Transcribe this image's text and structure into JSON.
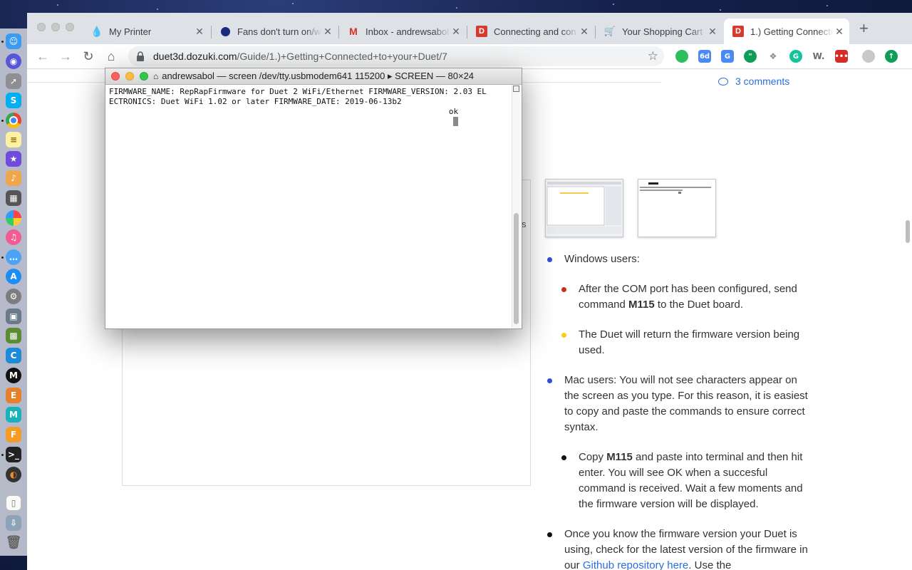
{
  "browser": {
    "tabs": [
      {
        "label": "My Printer",
        "favicon": "droplet-icon",
        "active": false
      },
      {
        "label": "Fans don't turn on/w",
        "favicon": "duet-icon",
        "active": false
      },
      {
        "label": "Inbox - andrewsabol",
        "favicon": "gmail-icon",
        "active": false
      },
      {
        "label": "Connecting and con",
        "favicon": "dozuki-icon",
        "active": false
      },
      {
        "label": "Your Shopping Cart",
        "favicon": "cart-icon",
        "active": false
      },
      {
        "label": "1.) Getting Connecte",
        "favicon": "dozuki-icon",
        "active": true
      }
    ],
    "address": {
      "host": "duet3d.dozuki.com",
      "path": "/Guide/1.)+Getting+Connected+to+your+Duet/7"
    },
    "extensions": [
      {
        "name": "evernote-icon",
        "label": "",
        "color": "#2dbe60"
      },
      {
        "name": "calendar-icon",
        "label": "6d",
        "color": "#4a8af4"
      },
      {
        "name": "translate-icon",
        "label": "G",
        "color": "#4a8af4"
      },
      {
        "name": "hangouts-icon",
        "label": "\"",
        "color": "#0f9d58"
      },
      {
        "name": "dropbox-icon",
        "label": "❖",
        "color": "#8a8a8a"
      },
      {
        "name": "grammarly-icon",
        "label": "G",
        "color": "#15c39a"
      },
      {
        "name": "wikipedia-icon",
        "label": "W.",
        "color": "#6b6b6b"
      },
      {
        "name": "lastpass-icon",
        "label": "•••",
        "color": "#d32d27"
      },
      {
        "name": "profile-icon",
        "label": "",
        "color": "#c9c9c9"
      },
      {
        "name": "update-icon",
        "label": "↑",
        "color": "#0f9d58"
      }
    ]
  },
  "terminal": {
    "title": "andrewsabol — screen /dev/tty.usbmodem641 115200 ▸ SCREEN — 80×24",
    "line1": "FIRMWARE_NAME: RepRapFirmware for Duet 2 WiFi/Ethernet FIRMWARE_VERSION: 2.03 EL",
    "line2": "ECTRONICS: Duet WiFi 1.02 or later FIRMWARE_DATE: 2019-06-13b2",
    "line3": "                                                                        ok"
  },
  "page": {
    "comments_link": "3 comments",
    "side_letter": "s",
    "steps": [
      {
        "level": 1,
        "color": "#2c4fd6",
        "parts": [
          {
            "t": "Windows users:"
          }
        ]
      },
      {
        "level": 2,
        "color": "#c0341d",
        "parts": [
          {
            "t": "After the COM port has been configured, send command "
          },
          {
            "t": "M115",
            "b": true
          },
          {
            "t": " to the Duet board."
          }
        ]
      },
      {
        "level": 2,
        "color": "#f1d20f",
        "parts": [
          {
            "t": "The Duet will return the firmware version being used."
          }
        ]
      },
      {
        "level": 1,
        "color": "#2c4fd6",
        "parts": [
          {
            "t": "Mac users: You will not see characters appear on the screen as you type. For this reason, it is easiest to copy and paste the commands to ensure correct syntax."
          }
        ]
      },
      {
        "level": 2,
        "color": "#111111",
        "parts": [
          {
            "t": "Copy "
          },
          {
            "t": "M115",
            "b": true
          },
          {
            "t": " and paste into terminal and then hit enter. You will see OK when a succesful command is received. Wait a few moments and the firmware version will be displayed."
          }
        ]
      },
      {
        "level": 1,
        "color": "#111111",
        "parts": [
          {
            "t": "Once you know the firmware version your Duet is using, check for the latest version of the firmware in our "
          },
          {
            "t": "Github repository here",
            "a": true
          },
          {
            "t": ". Use the"
          }
        ]
      }
    ]
  }
}
